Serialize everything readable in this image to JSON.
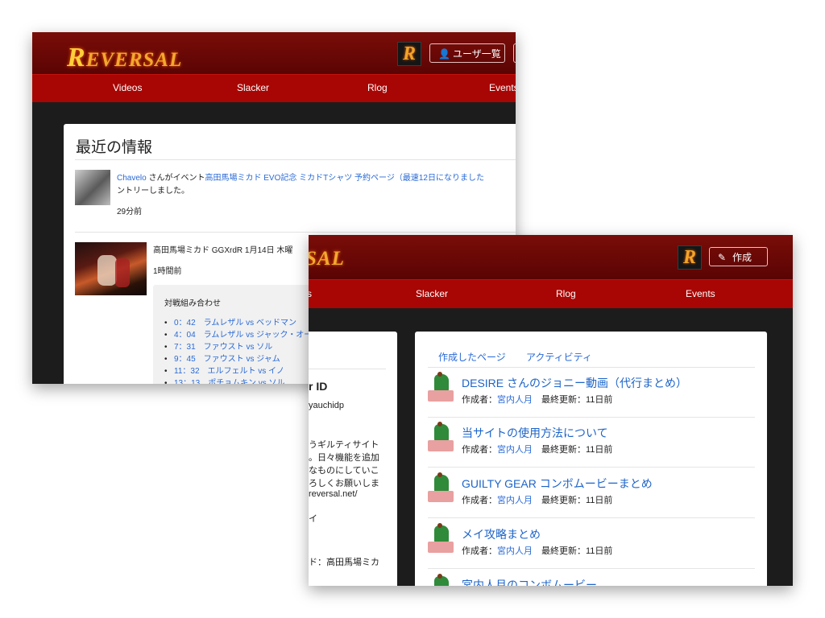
{
  "back_window": {
    "logo_text": "REVERSAL",
    "users_button_label": "ユーザ一覧",
    "nav": [
      "Videos",
      "Slacker",
      "Rlog",
      "Events"
    ],
    "section_title": "最近の情報",
    "activity1": {
      "user": "Chavelo",
      "mid_text": " さんがイベント",
      "event_link": "高田馬場ミカド EVO記念 ミカドTシャツ 予約ページ（最速12日になりました",
      "line2": "ントリーしました。",
      "time": "29分前"
    },
    "activity2": {
      "title_link": "高田馬場ミカド GGXrdR 1月14日 木曜",
      "time": "1時間前",
      "matches_label": "対戦組み合わせ",
      "matches": [
        "0：42　ラムレザル vs ベッドマン",
        "4：04　ラムレザル vs ジャック・オー",
        "7：31　ファウスト vs ソル",
        "9：45　ファウスト vs ジャム",
        "11：32　エルフェルト vs イノ",
        "13：13　ポチョムキン vs ソル"
      ]
    }
  },
  "front_window": {
    "logo_fragment": "SAL",
    "create_button_label": "作成",
    "nav": [
      "s",
      "Slacker",
      "Rlog",
      "Events"
    ],
    "profile": {
      "id_label": "r ID",
      "id_value": "yauchidp",
      "bio_lines": [
        "うギルティサイト",
        "。日々機能を追加",
        "なものにしていこ",
        "ろしくお願いしま",
        "reversal.net/",
        "イ",
        "ド：高田馬場ミカ"
      ]
    },
    "tabs": [
      "作成したページ",
      "アクティビティ"
    ],
    "pages": [
      {
        "title": "DESIRE さんのジョニー動画（代行まとめ）",
        "author_label": "作成者：",
        "author": "宮内人月",
        "updated": "最終更新：11日前"
      },
      {
        "title": "当サイトの使用方法について",
        "author_label": "作成者：",
        "author": "宮内人月",
        "updated": "最終更新：11日前"
      },
      {
        "title": "GUILTY GEAR コンボムービーまとめ",
        "author_label": "作成者：",
        "author": "宮内人月",
        "updated": "最終更新：11日前"
      },
      {
        "title": "メイ攻略まとめ",
        "author_label": "作成者：",
        "author": "宮内人月",
        "updated": "最終更新：11日前"
      },
      {
        "title": "宮内人月のコンボムービー",
        "author_label": "",
        "author": "",
        "updated": ""
      }
    ]
  }
}
